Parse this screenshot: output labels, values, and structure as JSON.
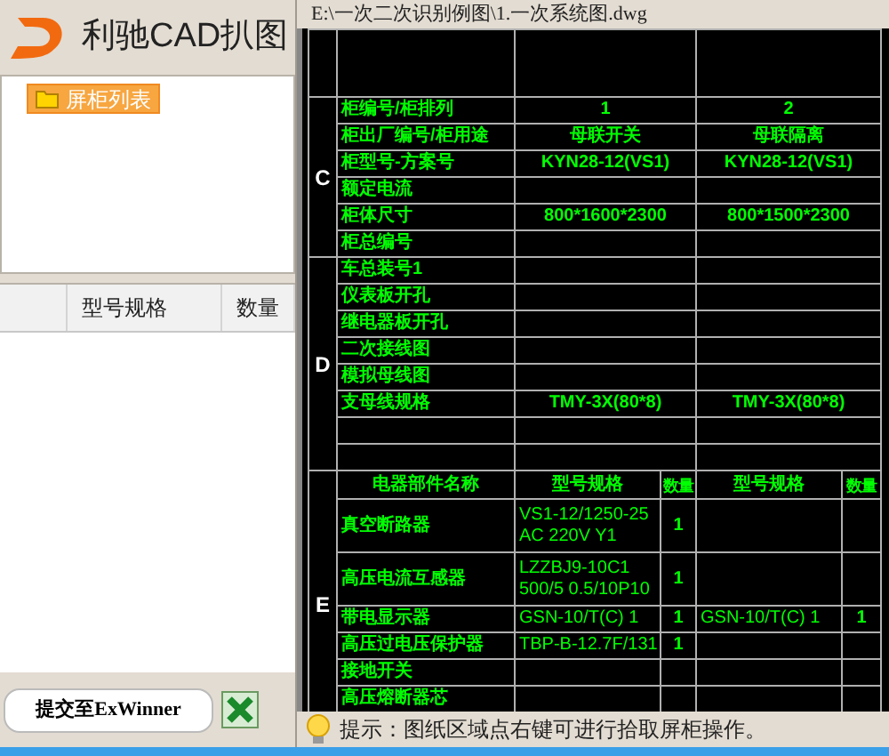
{
  "logo": {
    "name": "利驰CAD扒图"
  },
  "tree": {
    "items": [
      {
        "label": "屏柜列表",
        "selected": true
      }
    ]
  },
  "parts_table": {
    "columns": [
      "型号规格",
      "数量"
    ]
  },
  "submit_button": "提交至ExWinner",
  "file_path": "E:\\一次二次识别例图\\1.一次系统图.dwg",
  "drawing": {
    "sections": [
      {
        "letter": "C",
        "rows": [
          {
            "label": "柜编号/柜排列",
            "values": [
              "1",
              "2"
            ]
          },
          {
            "label": "柜出厂编号/柜用途",
            "values": [
              "母联开关",
              "母联隔离"
            ]
          },
          {
            "label": "柜型号-方案号",
            "values": [
              "KYN28-12(VS1)",
              "KYN28-12(VS1)"
            ]
          },
          {
            "label": "额定电流",
            "values": []
          },
          {
            "label": "柜体尺寸",
            "values": [
              "800*1600*2300",
              "800*1500*2300"
            ]
          },
          {
            "label": "柜总编号",
            "values": []
          }
        ]
      },
      {
        "letter": "D",
        "rows": [
          {
            "label": "车总装号1",
            "values": []
          },
          {
            "label": "仪表板开孔",
            "values": []
          },
          {
            "label": "继电器板开孔",
            "values": []
          },
          {
            "label": "二次接线图",
            "values": []
          },
          {
            "label": "模拟母线图",
            "values": []
          },
          {
            "label": "支母线规格",
            "values": [
              "TMY-3X(80*8)",
              "TMY-3X(80*8)"
            ]
          }
        ]
      }
    ],
    "parts": {
      "letter": "E",
      "columns": [
        "电器部件名称",
        "型号规格",
        "数量",
        "型号规格",
        "数量"
      ],
      "rows": [
        {
          "cells": [
            "真空断路器",
            "VS1-12/1250-25 AC 220V Y1",
            "1"
          ]
        },
        {
          "cells": [
            "高压电流互感器",
            "LZZBJ9-10C1 500/5 0.5/10P10",
            "1"
          ]
        },
        {
          "cells": [
            "带电显示器",
            "GSN-10/T(C) 1",
            "1",
            "GSN-10/T(C) 1",
            "1"
          ]
        },
        {
          "cells": [
            "高压过电压保护器",
            "TBP-B-12.7F/131",
            "1"
          ]
        },
        {
          "cells": [
            "接地开关"
          ]
        },
        {
          "cells": [
            "高压熔断器芯"
          ]
        }
      ]
    }
  },
  "status": "提示：图纸区域点右键可进行拾取屏柜操作。"
}
